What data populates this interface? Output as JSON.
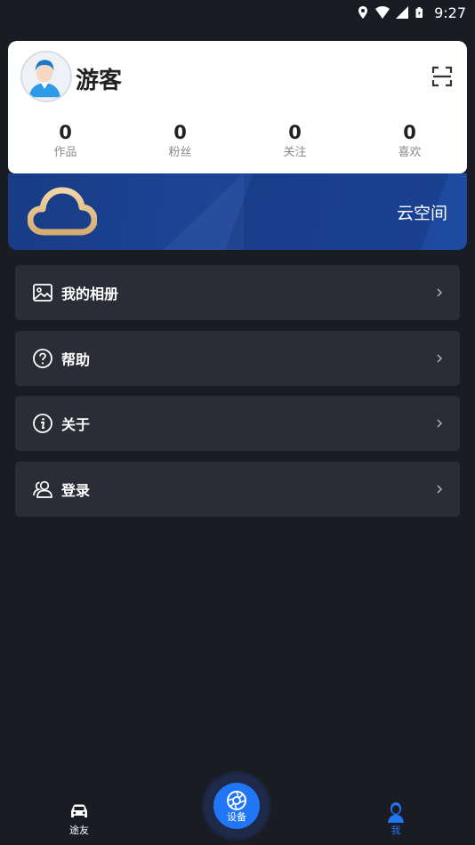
{
  "status_bar": {
    "time": "9:27"
  },
  "profile": {
    "username": "游客",
    "stats": [
      {
        "value": "0",
        "label": "作品"
      },
      {
        "value": "0",
        "label": "粉丝"
      },
      {
        "value": "0",
        "label": "关注"
      },
      {
        "value": "0",
        "label": "喜欢"
      }
    ]
  },
  "cloud_banner": {
    "label": "云空间"
  },
  "menu": [
    {
      "label": "我的相册",
      "icon": "image-icon"
    },
    {
      "label": "帮助",
      "icon": "help-icon"
    },
    {
      "label": "关于",
      "icon": "info-icon"
    },
    {
      "label": "登录",
      "icon": "users-icon"
    }
  ],
  "bottom_nav": {
    "left": {
      "label": "途友",
      "icon": "car-icon"
    },
    "center": {
      "label": "设备",
      "icon": "shutter-icon"
    },
    "right": {
      "label": "我",
      "icon": "person-icon"
    }
  },
  "colors": {
    "background": "#1a1c24",
    "card": "#2a2c36",
    "accent": "#2176f5",
    "banner": "#1c4597",
    "cloud": "#e8c590"
  }
}
